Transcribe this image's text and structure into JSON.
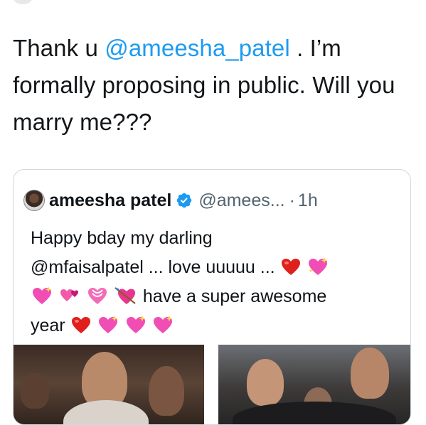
{
  "tweet": {
    "text_before": "Thank u ",
    "mention": "@ameesha_patel",
    "text_after": " . I’m formally proposing in public. Will you marry me???"
  },
  "quoted_tweet": {
    "name": "ameesha patel",
    "handle": "@amees...",
    "separator": "·",
    "time": "1h",
    "line1": "Happy bday my darling",
    "line2": "@mfaisalpatel ... love uuuuu ...",
    "line3_text": "have a super awesome",
    "line4_text": "year"
  },
  "colors": {
    "mention": "#1d9bf0",
    "verified": "#1d9bf0",
    "secondary_text": "#536471",
    "card_border": "#cfd9de"
  },
  "icons": {
    "verified": "verified-badge-icon",
    "heart": "red-heart-emoji",
    "sparkling_heart": "sparkling-heart-emoji",
    "revolving_hearts": "revolving-hearts-emoji",
    "heart_with_arrow": "heart-with-arrow-emoji"
  }
}
